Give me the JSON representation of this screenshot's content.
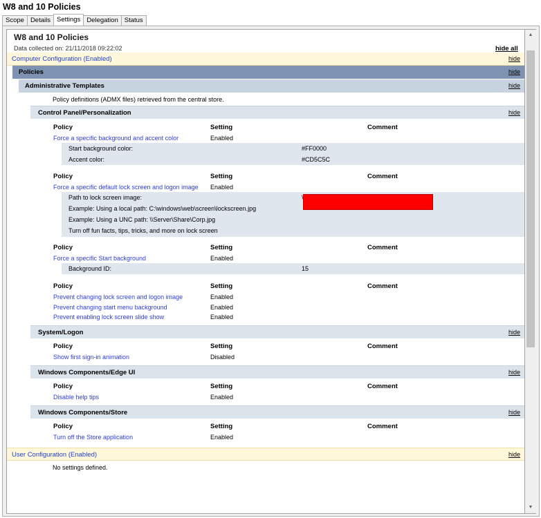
{
  "window": {
    "title": "W8 and 10 Policies",
    "tabs": [
      "Scope",
      "Details",
      "Settings",
      "Delegation",
      "Status"
    ],
    "active_tab": "Settings"
  },
  "report": {
    "title": "W8 and 10 Policies",
    "collected": "Data collected on: 21/11/2018 09:22:02",
    "hide_all": "hide all",
    "hide": "hide",
    "computer_config": "Computer Configuration (Enabled)",
    "policies": "Policies",
    "admin_templates": "Administrative Templates",
    "admx_note": "Policy definitions (ADMX files) retrieved from the central store.",
    "col_policy": "Policy",
    "col_setting": "Setting",
    "col_comment": "Comment",
    "sections": {
      "personalization": {
        "title": "Control Panel/Personalization",
        "p1": {
          "name": "Force a specific background and accent color",
          "setting": "Enabled",
          "details": [
            {
              "label": "Start background color:",
              "value": "#FF0000"
            },
            {
              "label": "Accent color:",
              "value": "#CD5C5C"
            }
          ]
        },
        "p2": {
          "name": "Force a specific default lock screen and logon image",
          "setting": "Enabled",
          "details": [
            "Path to lock screen image:",
            "Example: Using a local path: C:\\windows\\web\\screen\\lockscreen.jpg",
            "Example: Using a UNC path: \\\\Server\\Share\\Corp.jpg",
            "Turn off fun facts, tips, tricks, and more on lock screen"
          ],
          "path_prefix": "\\"
        },
        "p3": {
          "name": "Force a specific Start background",
          "setting": "Enabled",
          "details": [
            {
              "label": "Background ID:",
              "value": "15"
            }
          ]
        },
        "p4": [
          {
            "name": "Prevent changing lock screen and logon image",
            "setting": "Enabled"
          },
          {
            "name": "Prevent changing start menu background",
            "setting": "Enabled"
          },
          {
            "name": "Prevent enabling lock screen slide show",
            "setting": "Enabled"
          }
        ]
      },
      "logon": {
        "title": "System/Logon",
        "policy": {
          "name": "Show first sign-in animation",
          "setting": "Disabled"
        }
      },
      "edgeui": {
        "title": "Windows Components/Edge UI",
        "policy": {
          "name": "Disable help tips",
          "setting": "Enabled"
        }
      },
      "store": {
        "title": "Windows Components/Store",
        "policy": {
          "name": "Turn off the Store application",
          "setting": "Enabled"
        }
      }
    },
    "user_config": "User Configuration (Enabled)",
    "no_settings": "No settings defined."
  },
  "colors": {
    "link": "#2e3ddc",
    "config_band": "#fef7da",
    "policies_band": "#7d93b1",
    "redaction": "#ff0000"
  }
}
